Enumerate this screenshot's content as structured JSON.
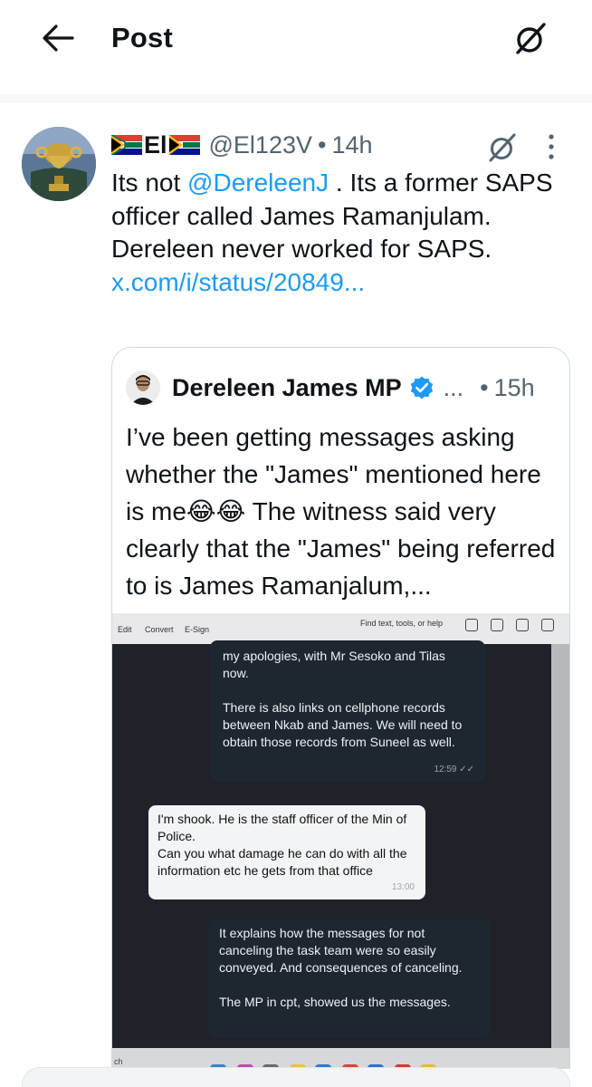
{
  "header": {
    "title": "Post",
    "back_icon": "arrow-left-icon",
    "grok_icon": "grok-icon"
  },
  "tweet": {
    "display_name": "El",
    "handle": "@El123V",
    "separator": "•",
    "time": "14h",
    "text_before_mention": "Its not ",
    "mention": "@DereleenJ",
    "text_after_mention": " . Its a former SAPS officer called James Ramanjulam. Dereleen never worked for SAPS.",
    "link": "x.com/i/status/20849..."
  },
  "quote": {
    "name": "Dereleen James MP",
    "ellipsis": "...",
    "separator": "•",
    "time": "15h",
    "text_line1": "I’ve been getting messages asking whether the \"James\" mentioned here is me",
    "emojis": "😂😂",
    "text_line2": " The witness said very clearly that the \"James\" being referred to is James Ramanjalum,..."
  },
  "photo": {
    "toolbar": {
      "edit": "Edit",
      "convert": "Convert",
      "esign": "E-Sign",
      "search": "Find text, tools, or help"
    },
    "messages": [
      {
        "text": "my apologies, with Mr Sesoko and Tilas now.\n\nThere is also links on cellphone records between Nkab and James. We will need to obtain those records from Suneel as well.",
        "time": "12:59 ✓✓"
      },
      {
        "text": "I'm shook. He is the staff officer of the Min of Police.\nCan you what damage he can do with all the information etc he gets from that office",
        "time": "13:00"
      },
      {
        "text": "It explains how the messages for not canceling the task team were so easily conveyed. And consequences of canceling.\n\nThe MP in cpt, showed us the messages.",
        "time": ""
      }
    ],
    "taskbar_label": "ch"
  },
  "colors": {
    "link": "#1d9bf0",
    "muted": "#536471",
    "verified": "#1d9bf0",
    "border": "#cfd9de"
  }
}
